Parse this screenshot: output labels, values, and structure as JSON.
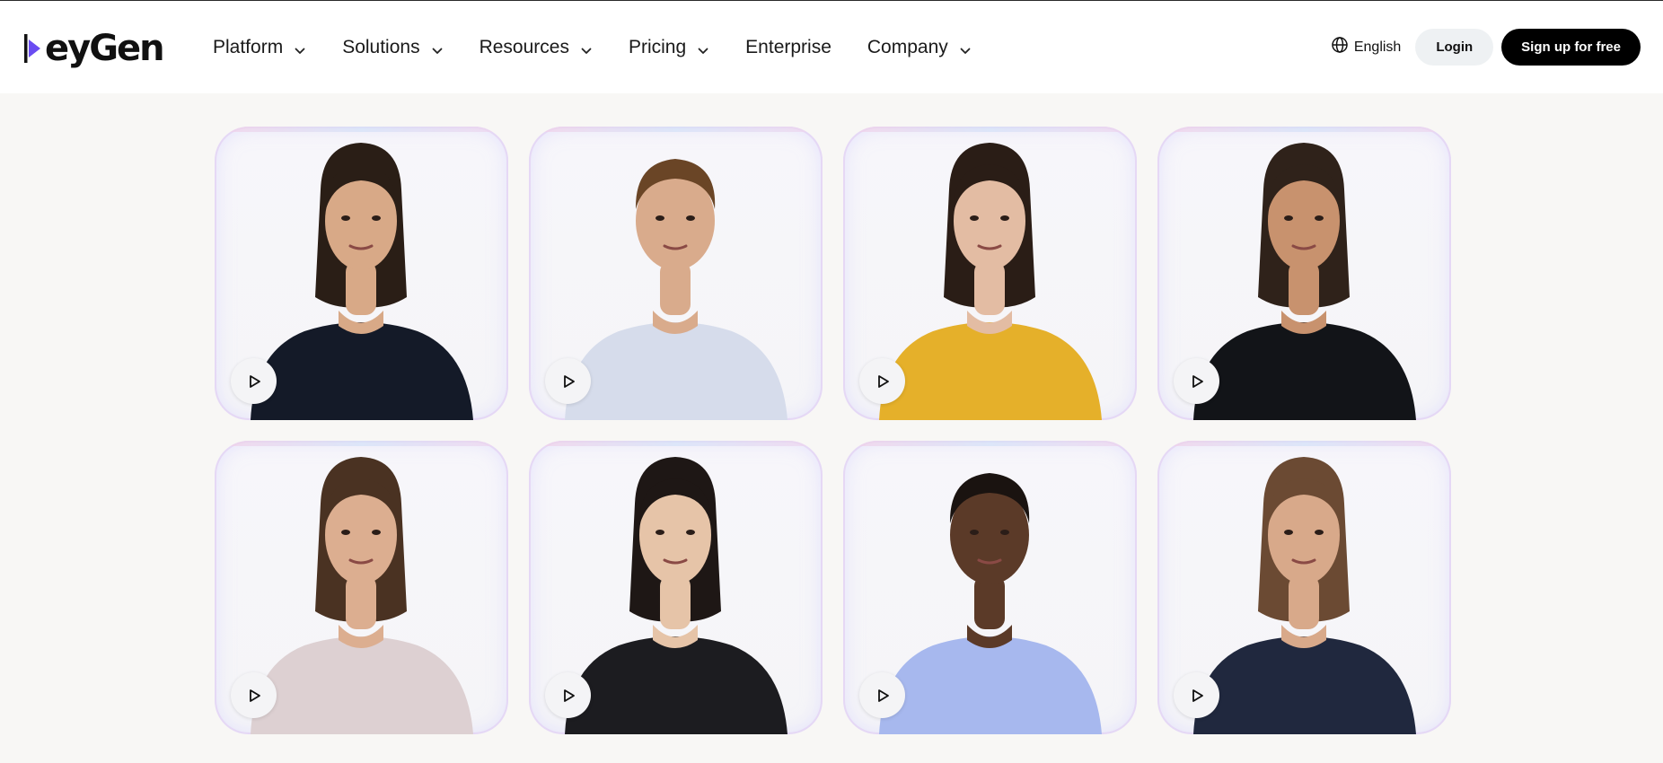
{
  "brand": {
    "name": "HeyGen",
    "logo_text": "eyGen"
  },
  "nav": {
    "items": [
      {
        "label": "Platform",
        "has_dropdown": true
      },
      {
        "label": "Solutions",
        "has_dropdown": true
      },
      {
        "label": "Resources",
        "has_dropdown": true
      },
      {
        "label": "Pricing",
        "has_dropdown": true
      },
      {
        "label": "Enterprise",
        "has_dropdown": false
      },
      {
        "label": "Company",
        "has_dropdown": true
      }
    ]
  },
  "header_right": {
    "language": "English",
    "globe_icon": "globe-icon",
    "login_label": "Login",
    "signup_label": "Sign up for free"
  },
  "avatars": [
    {
      "id": "avatar-1",
      "hair": "#2a1e16",
      "skin": "#d8a987",
      "top": "#141a28",
      "play_icon": "play-icon"
    },
    {
      "id": "avatar-2",
      "hair": "#6a4526",
      "skin": "#d9ab8c",
      "top": "#d6dceb",
      "play_icon": "play-icon"
    },
    {
      "id": "avatar-3",
      "hair": "#2a1d16",
      "skin": "#e3bca3",
      "top": "#e5b02a",
      "play_icon": "play-icon"
    },
    {
      "id": "avatar-4",
      "hair": "#2f221a",
      "skin": "#c8926e",
      "top": "#121418",
      "play_icon": "play-icon"
    },
    {
      "id": "avatar-5",
      "hair": "#4a3222",
      "skin": "#dcae90",
      "top": "#ddd0d2",
      "play_icon": "play-icon"
    },
    {
      "id": "avatar-6",
      "hair": "#1e1715",
      "skin": "#e6c4a8",
      "top": "#1c1c20",
      "play_icon": "play-icon"
    },
    {
      "id": "avatar-7",
      "hair": "#1a1310",
      "skin": "#5b3a28",
      "top": "#a7b8ee",
      "play_icon": "play-icon"
    },
    {
      "id": "avatar-8",
      "hair": "#6b4a33",
      "skin": "#d8a98a",
      "top": "#20283e",
      "play_icon": "play-icon"
    }
  ],
  "colors": {
    "header_bg": "#ffffff",
    "page_bg": "#f8f7f5",
    "signup_bg": "#000000",
    "login_bg": "#eef1f3"
  }
}
